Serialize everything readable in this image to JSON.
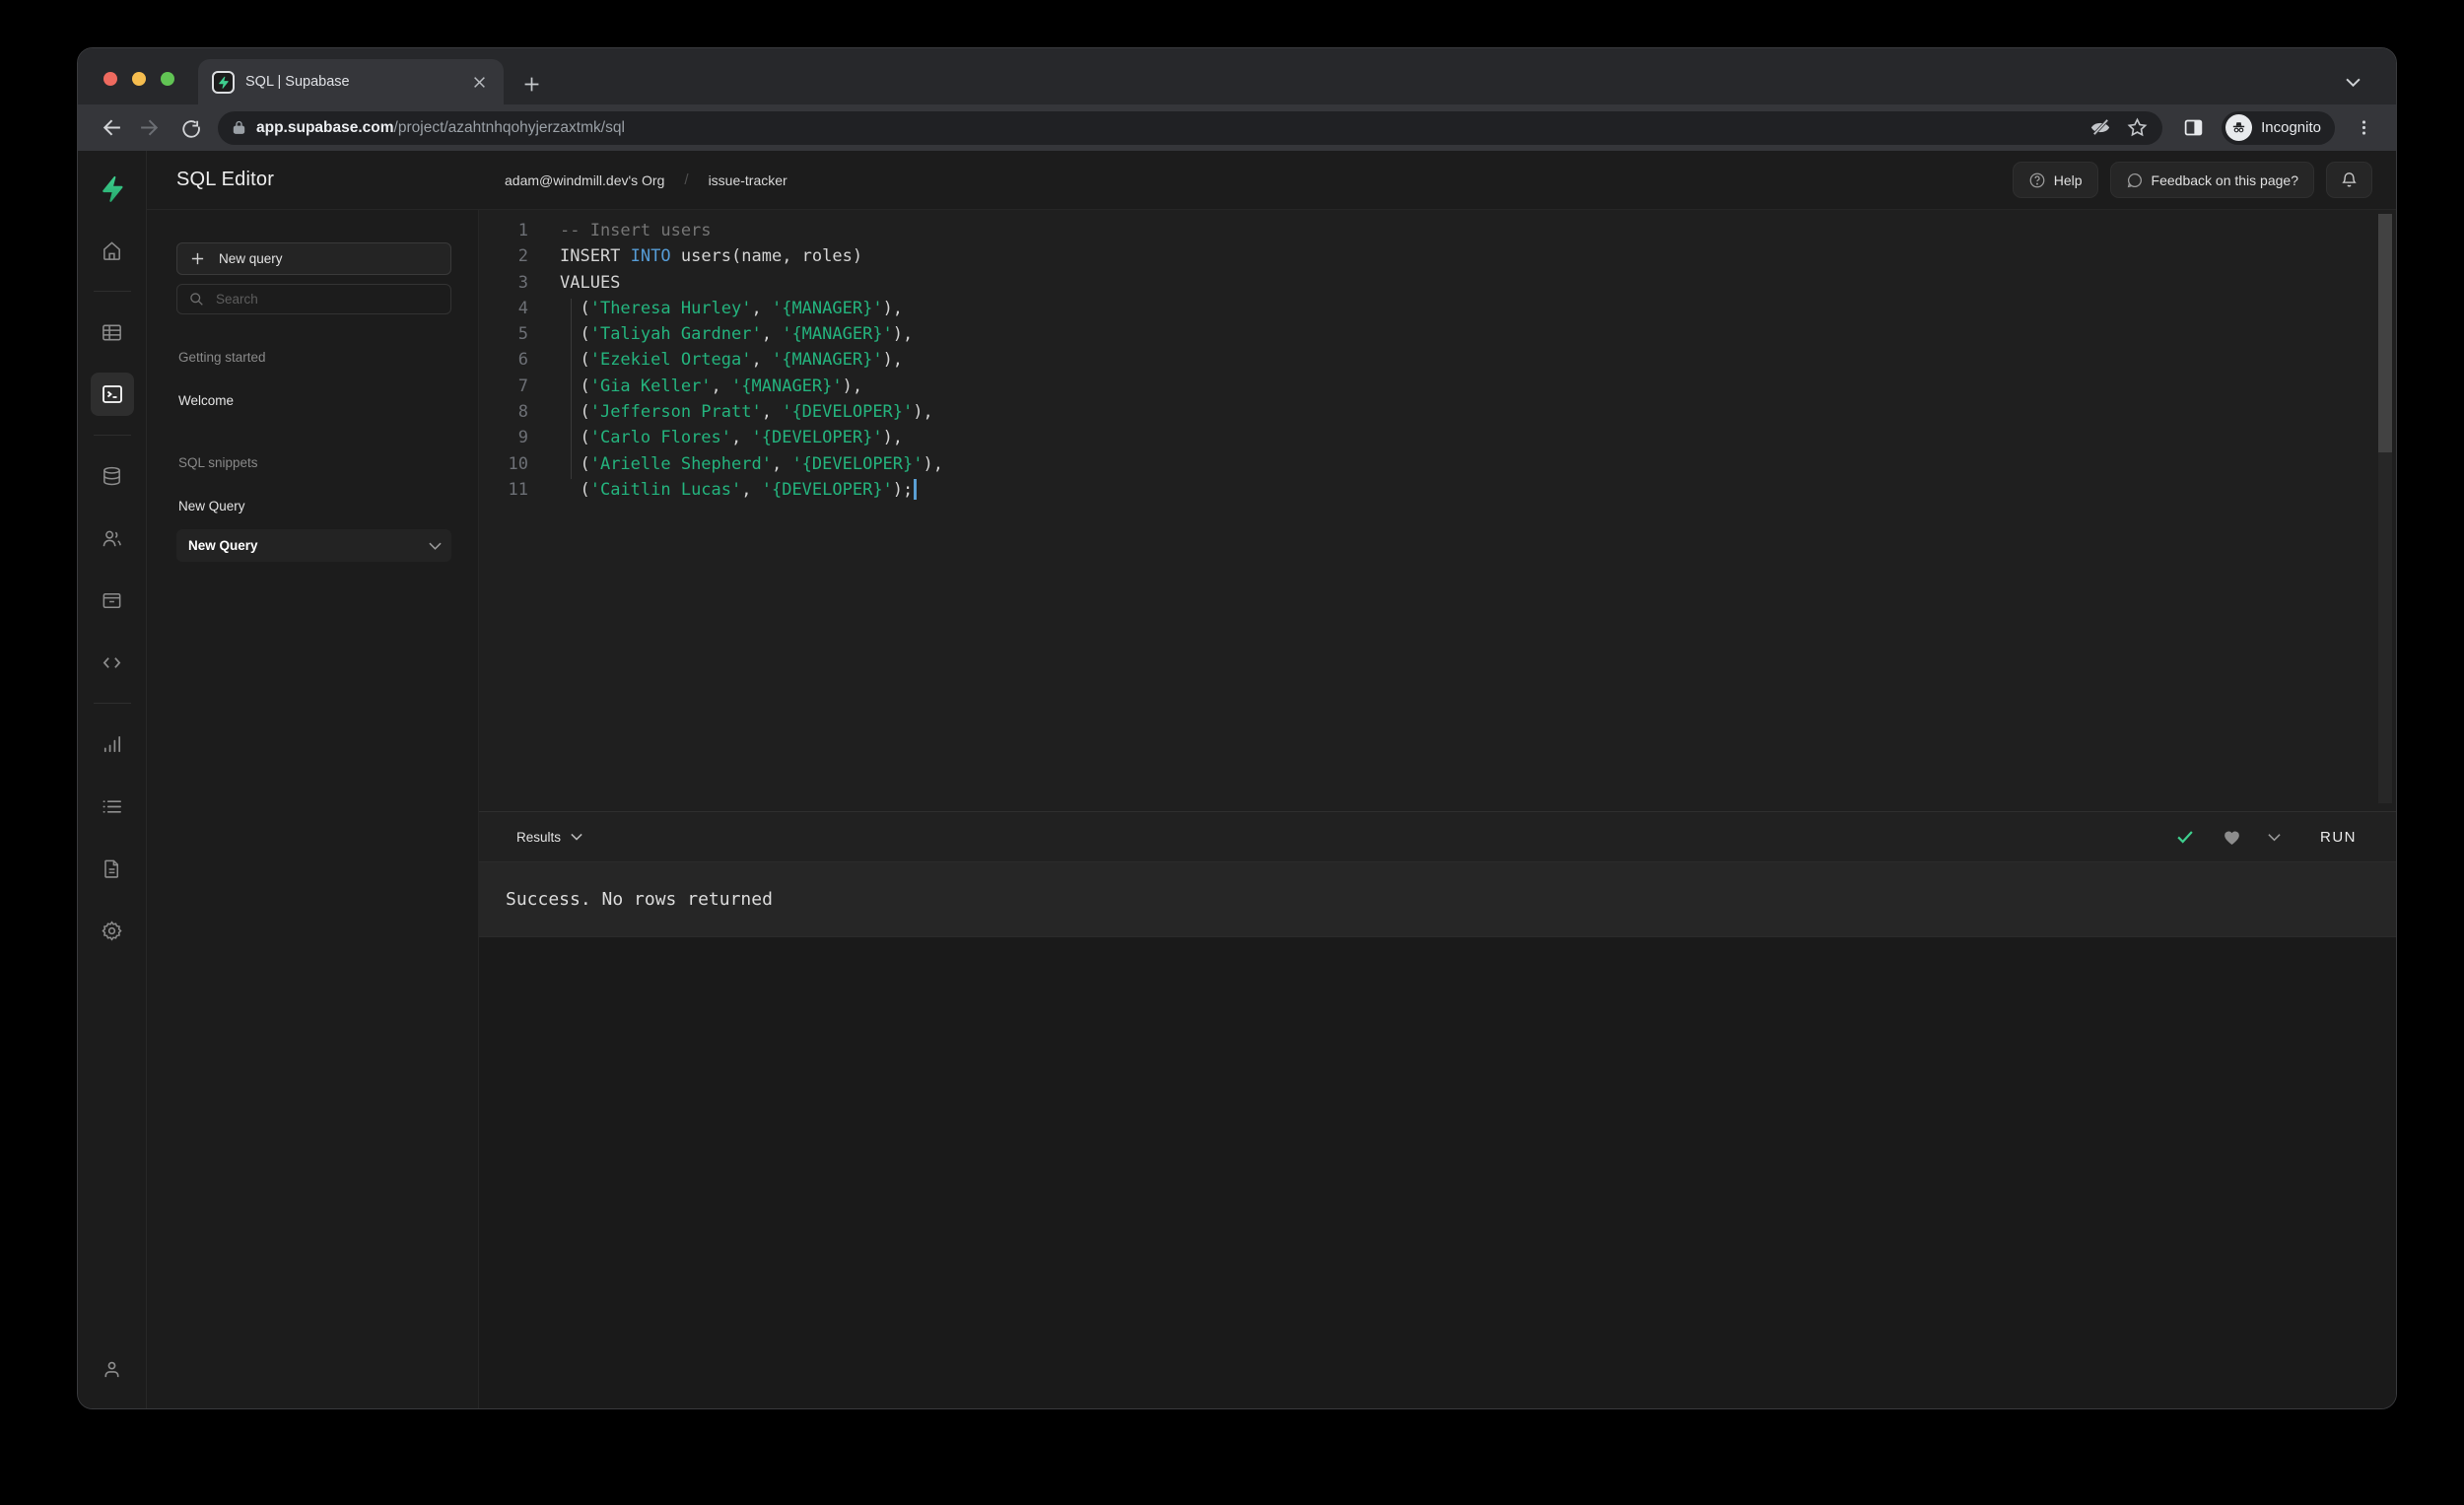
{
  "browser": {
    "tab_title": "SQL | Supabase",
    "url_host": "app.supabase.com",
    "url_path": "/project/azahtnhqohyjerzaxtmk/sql",
    "incognito_label": "Incognito",
    "traffic_lights": {
      "close": "#ee6a5f",
      "minimize": "#f5bd4f",
      "zoom": "#61c454"
    }
  },
  "sidebar": {
    "icons": [
      "supabase-logo",
      "home",
      "table-editor",
      "sql-editor",
      "database",
      "authentication",
      "storage",
      "edge-functions",
      "reports",
      "logs",
      "api-docs",
      "settings",
      "account"
    ],
    "active": "sql-editor"
  },
  "header": {
    "title": "SQL Editor",
    "breadcrumb": {
      "org": "adam@windmill.dev's Org",
      "separator": "/",
      "project": "issue-tracker"
    },
    "help_label": "Help",
    "feedback_label": "Feedback on this page?"
  },
  "panel": {
    "new_query_button": "New query",
    "search_placeholder": "Search",
    "getting_started_label": "Getting started",
    "welcome_item": "Welcome",
    "snippets_label": "SQL snippets",
    "snippet_item": "New Query",
    "active_item": "New Query"
  },
  "editor": {
    "cursor_line": 11,
    "lines": [
      {
        "tokens": [
          [
            "com",
            "-- Insert users"
          ]
        ]
      },
      {
        "tokens": [
          [
            "pln",
            "INSERT "
          ],
          [
            "kw",
            "INTO"
          ],
          [
            "pln",
            " users(name, roles)"
          ]
        ]
      },
      {
        "tokens": [
          [
            "pln",
            "VALUES"
          ]
        ]
      },
      {
        "tokens": [
          [
            "pln",
            "  ("
          ],
          [
            "str",
            "'Theresa Hurley'"
          ],
          [
            "pln",
            ", "
          ],
          [
            "str",
            "'{MANAGER}'"
          ],
          [
            "pln",
            "),"
          ]
        ]
      },
      {
        "tokens": [
          [
            "pln",
            "  ("
          ],
          [
            "str",
            "'Taliyah Gardner'"
          ],
          [
            "pln",
            ", "
          ],
          [
            "str",
            "'{MANAGER}'"
          ],
          [
            "pln",
            "),"
          ]
        ]
      },
      {
        "tokens": [
          [
            "pln",
            "  ("
          ],
          [
            "str",
            "'Ezekiel Ortega'"
          ],
          [
            "pln",
            ", "
          ],
          [
            "str",
            "'{MANAGER}'"
          ],
          [
            "pln",
            "),"
          ]
        ]
      },
      {
        "tokens": [
          [
            "pln",
            "  ("
          ],
          [
            "str",
            "'Gia Keller'"
          ],
          [
            "pln",
            ", "
          ],
          [
            "str",
            "'{MANAGER}'"
          ],
          [
            "pln",
            "),"
          ]
        ]
      },
      {
        "tokens": [
          [
            "pln",
            "  ("
          ],
          [
            "str",
            "'Jefferson Pratt'"
          ],
          [
            "pln",
            ", "
          ],
          [
            "str",
            "'{DEVELOPER}'"
          ],
          [
            "pln",
            "),"
          ]
        ]
      },
      {
        "tokens": [
          [
            "pln",
            "  ("
          ],
          [
            "str",
            "'Carlo Flores'"
          ],
          [
            "pln",
            ", "
          ],
          [
            "str",
            "'{DEVELOPER}'"
          ],
          [
            "pln",
            "),"
          ]
        ]
      },
      {
        "tokens": [
          [
            "pln",
            "  ("
          ],
          [
            "str",
            "'Arielle Shepherd'"
          ],
          [
            "pln",
            ", "
          ],
          [
            "str",
            "'{DEVELOPER}'"
          ],
          [
            "pln",
            "),"
          ]
        ]
      },
      {
        "tokens": [
          [
            "pln",
            "  ("
          ],
          [
            "str",
            "'Caitlin Lucas'"
          ],
          [
            "pln",
            ", "
          ],
          [
            "str",
            "'{DEVELOPER}'"
          ],
          [
            "pln",
            ");"
          ]
        ]
      }
    ]
  },
  "results": {
    "label": "Results",
    "run_label": "RUN",
    "message": "Success. No rows returned"
  },
  "colors": {
    "accent_green": "#3ecf8e",
    "string_green": "#24b47e",
    "keyword_blue": "#569cd6",
    "editor_bg": "#1f1f1f",
    "app_bg": "#1c1c1c",
    "chrome_bg": "#35363a",
    "urlbar_bg": "#202124"
  }
}
